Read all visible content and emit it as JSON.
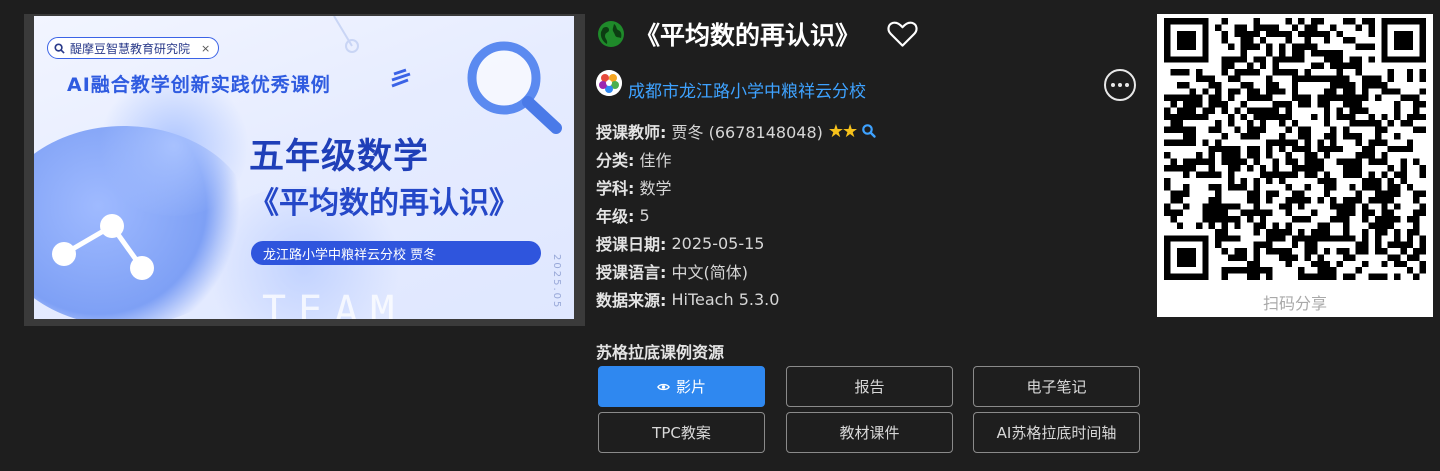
{
  "thumbnail": {
    "chip_text": "醍摩豆智慧教育研究院",
    "chip_close": "×",
    "subtitle": "AI融合教学创新实践优秀课例",
    "title_line1": "五年级数学",
    "title_line2": "《平均数的再认识》",
    "band_text": "龙江路小学中粮祥云分校  贾冬",
    "watermark": "TEAM MODEL",
    "date_vertical": "2025.05"
  },
  "header": {
    "title": "《平均数的再认识》",
    "school": "成都市龙江路小学中粮祥云分校"
  },
  "info": {
    "teacher_label": "授课教师:",
    "teacher_value": "贾冬 (6678148048)",
    "stars": "★★",
    "category_label": "分类:",
    "category_value": "佳作",
    "subject_label": "学科:",
    "subject_value": "数学",
    "grade_label": "年级:",
    "grade_value": "5",
    "date_label": "授课日期:",
    "date_value": "2025-05-15",
    "language_label": "授课语言:",
    "language_value": "中文(简体)",
    "source_label": "数据来源:",
    "source_value": "HiTeach 5.3.0"
  },
  "resources": {
    "heading": "苏格拉底课例资源",
    "buttons": [
      "影片",
      "报告",
      "电子笔记",
      "TPC教案",
      "教材课件",
      "AI苏格拉底时间轴"
    ]
  },
  "qr": {
    "caption": "扫码分享"
  },
  "colors": {
    "background": "#1e1e1e",
    "accent_blue": "#2f88f0",
    "link_blue": "#3ea2ff",
    "star_gold": "#f7c21b"
  },
  "icons": [
    "globe-icon",
    "heart-icon",
    "more-icon",
    "search-icon",
    "eye-icon",
    "qr-code"
  ]
}
